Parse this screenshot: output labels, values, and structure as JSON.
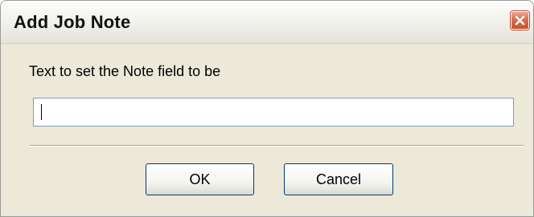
{
  "dialog": {
    "title": "Add Job Note",
    "prompt": "Text to set the Note field to be",
    "note_value": "",
    "ok_label": "OK",
    "cancel_label": "Cancel"
  },
  "icons": {
    "close": "close-icon"
  },
  "colors": {
    "dialog_background": "#ece9d8",
    "close_button": "#d8704f",
    "input_border": "#7f9db9",
    "button_border": "#003c74"
  }
}
